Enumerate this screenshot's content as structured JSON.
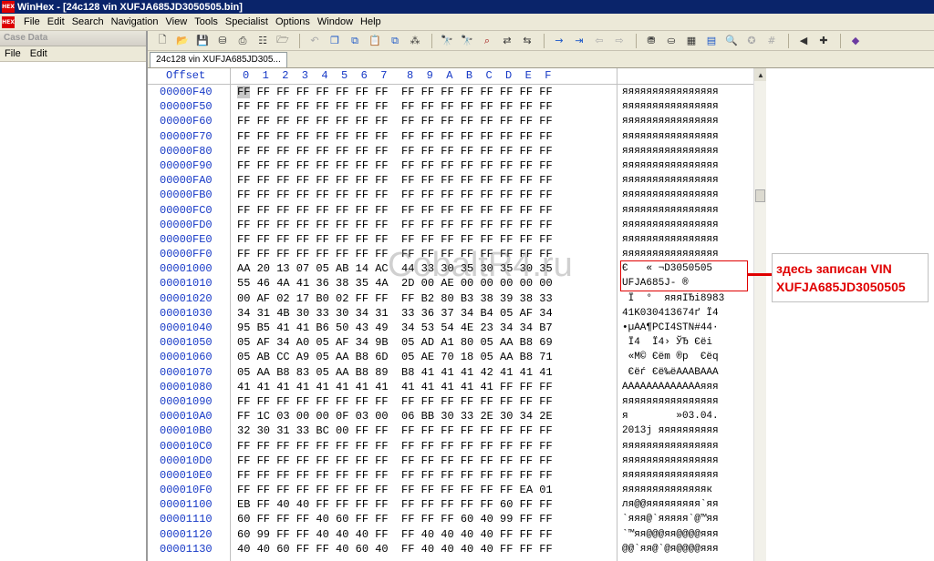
{
  "window": {
    "title": "WinHex - [24c128 vin XUFJA685JD3050505.bin]"
  },
  "menu": [
    "File",
    "Edit",
    "Search",
    "Navigation",
    "View",
    "Tools",
    "Specialist",
    "Options",
    "Window",
    "Help"
  ],
  "case_panel": {
    "title": "Case Data",
    "menu": [
      "File",
      "Edit"
    ]
  },
  "tab": {
    "label": "24c128 vin XUFJA685JD305..."
  },
  "hex": {
    "header_offset": "Offset",
    "header_columns": "0  1  2  3  4  5  6  7   8  9  A  B  C  D  E  F",
    "rows": [
      {
        "offset": "00000F40",
        "bytes": "FF FF FF FF FF FF FF FF  FF FF FF FF FF FF FF FF",
        "ascii": "яяяяяяяяяяяяяяяя"
      },
      {
        "offset": "00000F50",
        "bytes": "FF FF FF FF FF FF FF FF  FF FF FF FF FF FF FF FF",
        "ascii": "яяяяяяяяяяяяяяяя"
      },
      {
        "offset": "00000F60",
        "bytes": "FF FF FF FF FF FF FF FF  FF FF FF FF FF FF FF FF",
        "ascii": "яяяяяяяяяяяяяяяя"
      },
      {
        "offset": "00000F70",
        "bytes": "FF FF FF FF FF FF FF FF  FF FF FF FF FF FF FF FF",
        "ascii": "яяяяяяяяяяяяяяяя"
      },
      {
        "offset": "00000F80",
        "bytes": "FF FF FF FF FF FF FF FF  FF FF FF FF FF FF FF FF",
        "ascii": "яяяяяяяяяяяяяяяя"
      },
      {
        "offset": "00000F90",
        "bytes": "FF FF FF FF FF FF FF FF  FF FF FF FF FF FF FF FF",
        "ascii": "яяяяяяяяяяяяяяяя"
      },
      {
        "offset": "00000FA0",
        "bytes": "FF FF FF FF FF FF FF FF  FF FF FF FF FF FF FF FF",
        "ascii": "яяяяяяяяяяяяяяяя"
      },
      {
        "offset": "00000FB0",
        "bytes": "FF FF FF FF FF FF FF FF  FF FF FF FF FF FF FF FF",
        "ascii": "яяяяяяяяяяяяяяяя"
      },
      {
        "offset": "00000FC0",
        "bytes": "FF FF FF FF FF FF FF FF  FF FF FF FF FF FF FF FF",
        "ascii": "яяяяяяяяяяяяяяяя"
      },
      {
        "offset": "00000FD0",
        "bytes": "FF FF FF FF FF FF FF FF  FF FF FF FF FF FF FF FF",
        "ascii": "яяяяяяяяяяяяяяяя"
      },
      {
        "offset": "00000FE0",
        "bytes": "FF FF FF FF FF FF FF FF  FF FF FF FF FF FF FF FF",
        "ascii": "яяяяяяяяяяяяяяяя"
      },
      {
        "offset": "00000FF0",
        "bytes": "FF FF FF FF FF FF FF FF  FF FF FF FF FF FF FF FF",
        "ascii": "яяяяяяяяяяяяяяяя"
      },
      {
        "offset": "00001000",
        "bytes": "AA 20 13 07 05 AB 14 AC  44 33 30 35 30 35 30 35",
        "ascii": "Є   « ¬D3050505"
      },
      {
        "offset": "00001010",
        "bytes": "55 46 4A 41 36 38 35 4A  2D 00 AE 00 00 00 00 00",
        "ascii": "UFJA685J- ®"
      },
      {
        "offset": "00001020",
        "bytes": "00 AF 02 17 B0 02 FF FF  FF B2 80 B3 38 39 38 33",
        "ascii": " Ї  °  яяяІЂі8983"
      },
      {
        "offset": "00001030",
        "bytes": "34 31 4B 30 33 30 34 31  33 36 37 34 B4 05 AF 34",
        "ascii": "41K030413674ґ Ї4"
      },
      {
        "offset": "00001040",
        "bytes": "95 B5 41 41 B6 50 43 49  34 53 54 4E 23 34 34 B7",
        "ascii": "•µAA¶PCI4STN#44·"
      },
      {
        "offset": "00001050",
        "bytes": "05 AF 34 A0 05 AF 34 9B  05 AD A1 80 05 AA B8 69",
        "ascii": " Ї4  Ї4› ­ЎЂ Єёi"
      },
      {
        "offset": "00001060",
        "bytes": "05 AB CC A9 05 AA B8 6D  05 AE 70 18 05 AA B8 71",
        "ascii": " «М© Єёm ®p  Єёq"
      },
      {
        "offset": "00001070",
        "bytes": "05 AA B8 83 05 AA B8 89  B8 41 41 41 42 41 41 41",
        "ascii": " Єёѓ Єё‰ёAAABAAA"
      },
      {
        "offset": "00001080",
        "bytes": "41 41 41 41 41 41 41 41  41 41 41 41 41 FF FF FF",
        "ascii": "AAAAAAAAAAAAAяяя"
      },
      {
        "offset": "00001090",
        "bytes": "FF FF FF FF FF FF FF FF  FF FF FF FF FF FF FF FF",
        "ascii": "яяяяяяяяяяяяяяяя"
      },
      {
        "offset": "000010A0",
        "bytes": "FF 1C 03 00 00 0F 03 00  06 BB 30 33 2E 30 34 2E",
        "ascii": "я        »03.04."
      },
      {
        "offset": "000010B0",
        "bytes": "32 30 31 33 BC 00 FF FF  FF FF FF FF FF FF FF FF",
        "ascii": "2013ј яяяяяяяяяя"
      },
      {
        "offset": "000010C0",
        "bytes": "FF FF FF FF FF FF FF FF  FF FF FF FF FF FF FF FF",
        "ascii": "яяяяяяяяяяяяяяяя"
      },
      {
        "offset": "000010D0",
        "bytes": "FF FF FF FF FF FF FF FF  FF FF FF FF FF FF FF FF",
        "ascii": "яяяяяяяяяяяяяяяя"
      },
      {
        "offset": "000010E0",
        "bytes": "FF FF FF FF FF FF FF FF  FF FF FF FF FF FF FF FF",
        "ascii": "яяяяяяяяяяяяяяяя"
      },
      {
        "offset": "000010F0",
        "bytes": "FF FF FF FF FF FF FF FF  FF FF FF FF FF FF EA 01",
        "ascii": "яяяяяяяяяяяяяяк"
      },
      {
        "offset": "00001100",
        "bytes": "EB FF 40 40 FF FF FF FF  FF FF FF FF FF 60 FF FF",
        "ascii": "ля@@яяяяяяяяя`яя"
      },
      {
        "offset": "00001110",
        "bytes": "60 FF FF FF 40 60 FF FF  FF FF FF 60 40 99 FF FF",
        "ascii": "`яяя@`яяяяя`@™яя"
      },
      {
        "offset": "00001120",
        "bytes": "60 99 FF FF 40 40 40 FF  FF 40 40 40 40 FF FF FF",
        "ascii": "`™яя@@@яя@@@@яяя"
      },
      {
        "offset": "00001130",
        "bytes": "40 40 60 FF FF 40 60 40  FF 40 40 40 40 FF FF FF",
        "ascii": "@@`яя@`@я@@@@яяя"
      }
    ]
  },
  "annotation": {
    "line1": "здесь записан VIN",
    "line2": "XUFJA685JD3050505",
    "color": "#e00000"
  },
  "watermark": "CobaltR4.ru"
}
